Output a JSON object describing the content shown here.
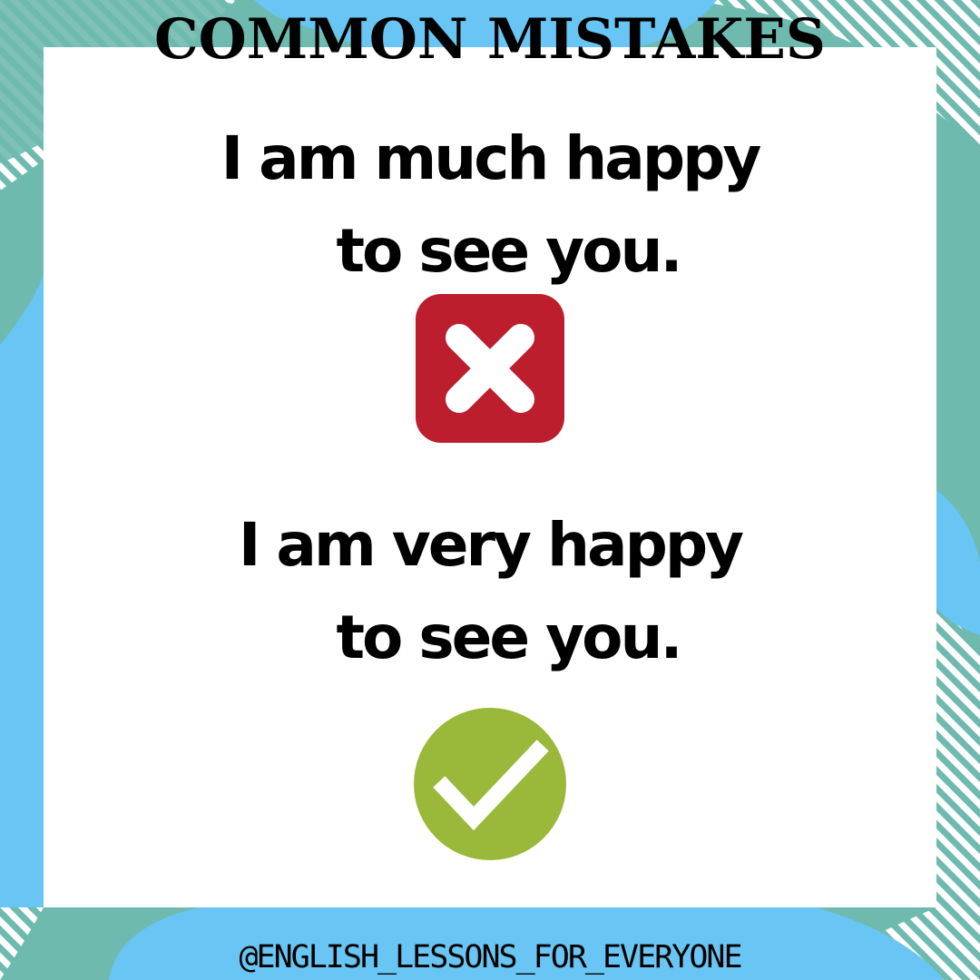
{
  "title": "COMMON MISTAKES",
  "wrong_example": {
    "line1": "I am much happy",
    "line2": "to see you.",
    "icon": "cross-mark-icon",
    "icon_color": "#bd1e2d"
  },
  "correct_example": {
    "line1": "I am very happy",
    "line2": "to see you.",
    "icon": "check-mark-icon",
    "icon_color": "#9ab93a"
  },
  "handle": "@ENGLISH_LESSONS_FOR_EVERYONE",
  "colors": {
    "teal": "#6fbaaf",
    "sky_blue": "#69c5f3",
    "card": "#ffffff"
  }
}
